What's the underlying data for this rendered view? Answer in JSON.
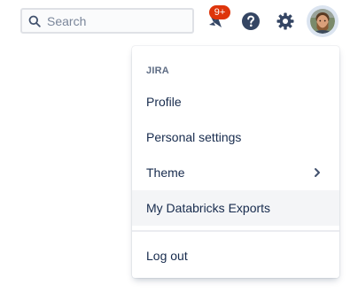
{
  "header": {
    "search": {
      "placeholder": "Search",
      "value": ""
    },
    "notifications": {
      "badge": "9+",
      "icon": "notification-icon"
    },
    "help": {
      "icon": "question-circle-icon"
    },
    "settings": {
      "icon": "gear-icon"
    },
    "profile": {
      "icon": "avatar"
    }
  },
  "menu": {
    "section_heading": "JIRA",
    "items": [
      {
        "label": "Profile"
      },
      {
        "label": "Personal settings"
      },
      {
        "label": "Theme",
        "icon": "chevron-right-icon"
      },
      {
        "label": "My Databricks Exports"
      }
    ],
    "logout": {
      "label": "Log out"
    }
  },
  "colors": {
    "badge": "#de350b",
    "icon": "#344563",
    "hover_bg": "#f4f5f7"
  }
}
